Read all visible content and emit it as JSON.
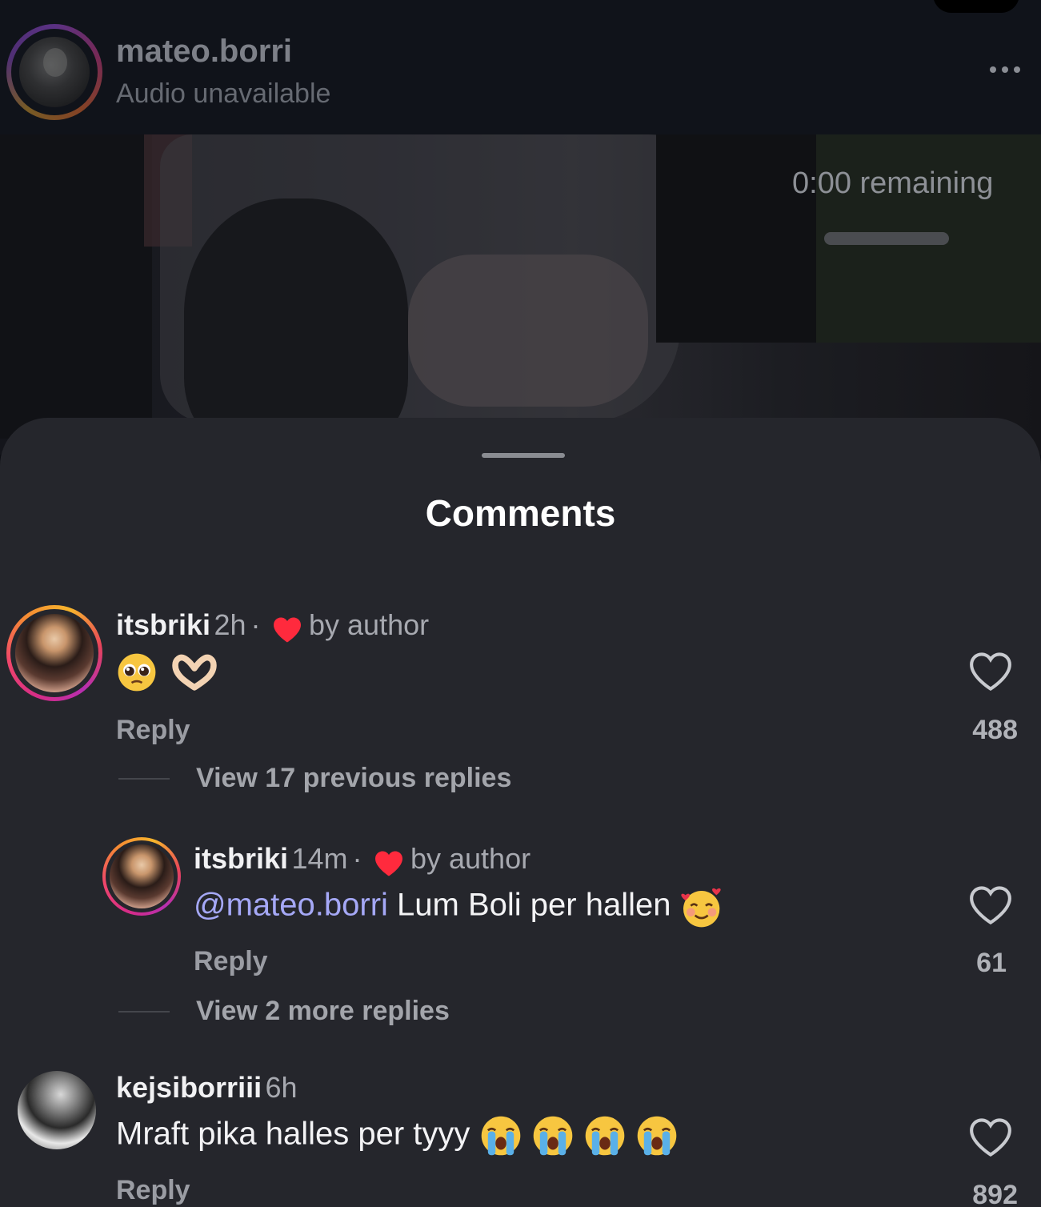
{
  "header": {
    "username": "mateo.borri",
    "subtitle": "Audio unavailable"
  },
  "video": {
    "time_remaining": "0:00 remaining"
  },
  "sheet": {
    "title": "Comments"
  },
  "comments": [
    {
      "username": "itsbriki",
      "time": "2h",
      "liked_by_author": "by author",
      "emoji": [
        "pleading-face",
        "heart-hands"
      ],
      "reply_label": "Reply",
      "likes": "488",
      "view_replies": "View 17 previous replies"
    },
    {
      "username": "itsbriki",
      "time": "14m",
      "liked_by_author": "by author",
      "mention": "@mateo.borri",
      "text": "Lum Boli per hallen",
      "emoji": [
        "smiling-face-with-hearts"
      ],
      "reply_label": "Reply",
      "likes": "61",
      "view_replies": "View 2 more replies"
    },
    {
      "username": "kejsiborriii",
      "time": "6h",
      "text": "Mraft pika halles per tyyy",
      "emoji": [
        "loudly-crying-face",
        "loudly-crying-face",
        "loudly-crying-face",
        "loudly-crying-face"
      ],
      "reply_label": "Reply",
      "likes": "892"
    }
  ],
  "colors": {
    "sheet_bg": "#25262c",
    "heart_red": "#ff2a3d",
    "mention": "#a5a8f6"
  }
}
